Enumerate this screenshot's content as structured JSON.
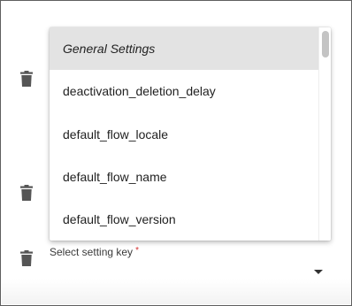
{
  "dropdown": {
    "options": [
      {
        "label": "General Settings",
        "kind": "group-header"
      },
      {
        "label": "deactivation_deletion_delay"
      },
      {
        "label": "default_flow_locale"
      },
      {
        "label": "default_flow_name"
      },
      {
        "label": "default_flow_version"
      }
    ]
  },
  "field": {
    "label": "Select setting key",
    "required_marker": "*",
    "value": ""
  },
  "icons": {
    "delete": "trash-icon",
    "caret": "dropdown-caret-icon"
  },
  "colors": {
    "header_bg": "#e3e3e3",
    "required": "#d32f2f",
    "icon": "#555555"
  }
}
